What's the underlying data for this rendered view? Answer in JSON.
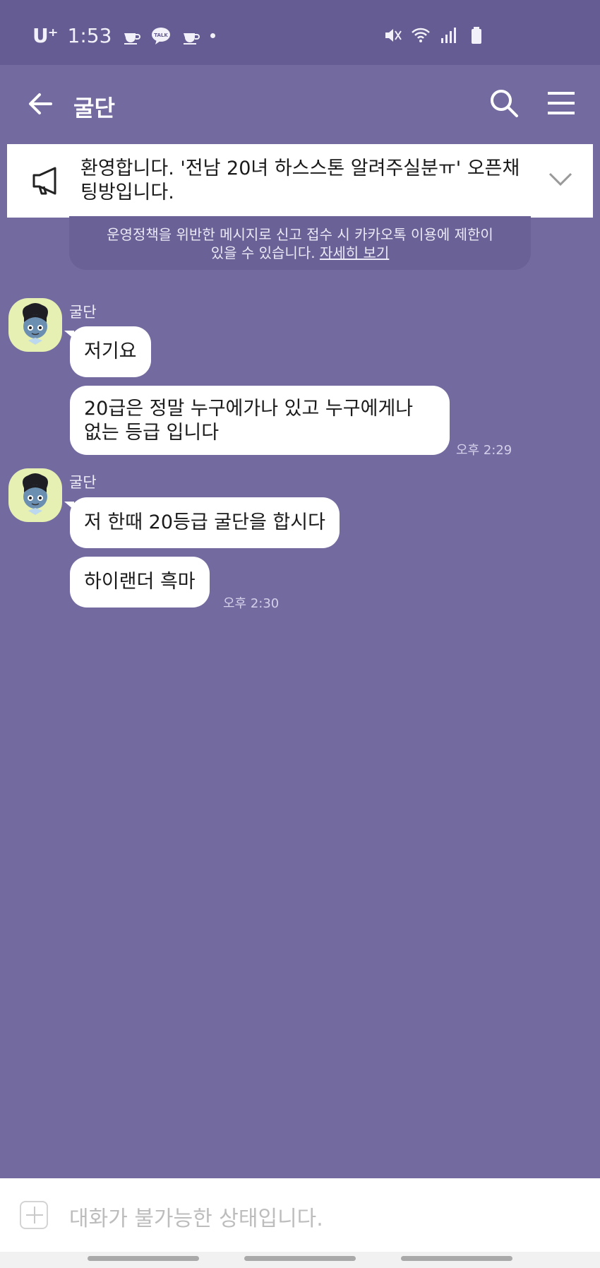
{
  "status_bar": {
    "carrier": "U⁺",
    "time": "1:53",
    "talk_icon_text": "TALK"
  },
  "header": {
    "title": "굴단"
  },
  "notice": {
    "text": "환영합니다. '전남 20녀 하스스톤 알려주실분ㅠ' 오픈채팅방입니다."
  },
  "policy": {
    "text": "운영정책을 위반한 메시지로 신고 접수 시 카카오톡 이용에 제한이",
    "text2": "있을 수 있습니다.",
    "link": "자세히 보기"
  },
  "messages": [
    {
      "sender": "굴단",
      "bubbles": [
        "저기요",
        "20급은 정말 누구에가나 있고 누구에게나 없는 등급 입니다"
      ],
      "time": "오후 2:29"
    },
    {
      "sender": "굴단",
      "bubbles": [
        "저 한때 20등급 굴단을 합시다",
        "하이랜더 흑마"
      ],
      "time": "오후 2:30"
    }
  ],
  "input": {
    "placeholder": "대화가 불가능한 상태입니다."
  },
  "colors": {
    "chat_background": "#736aa0",
    "status_bar": "#645c92",
    "bubble": "#ffffff",
    "avatar_background": "#e6f0b2"
  }
}
